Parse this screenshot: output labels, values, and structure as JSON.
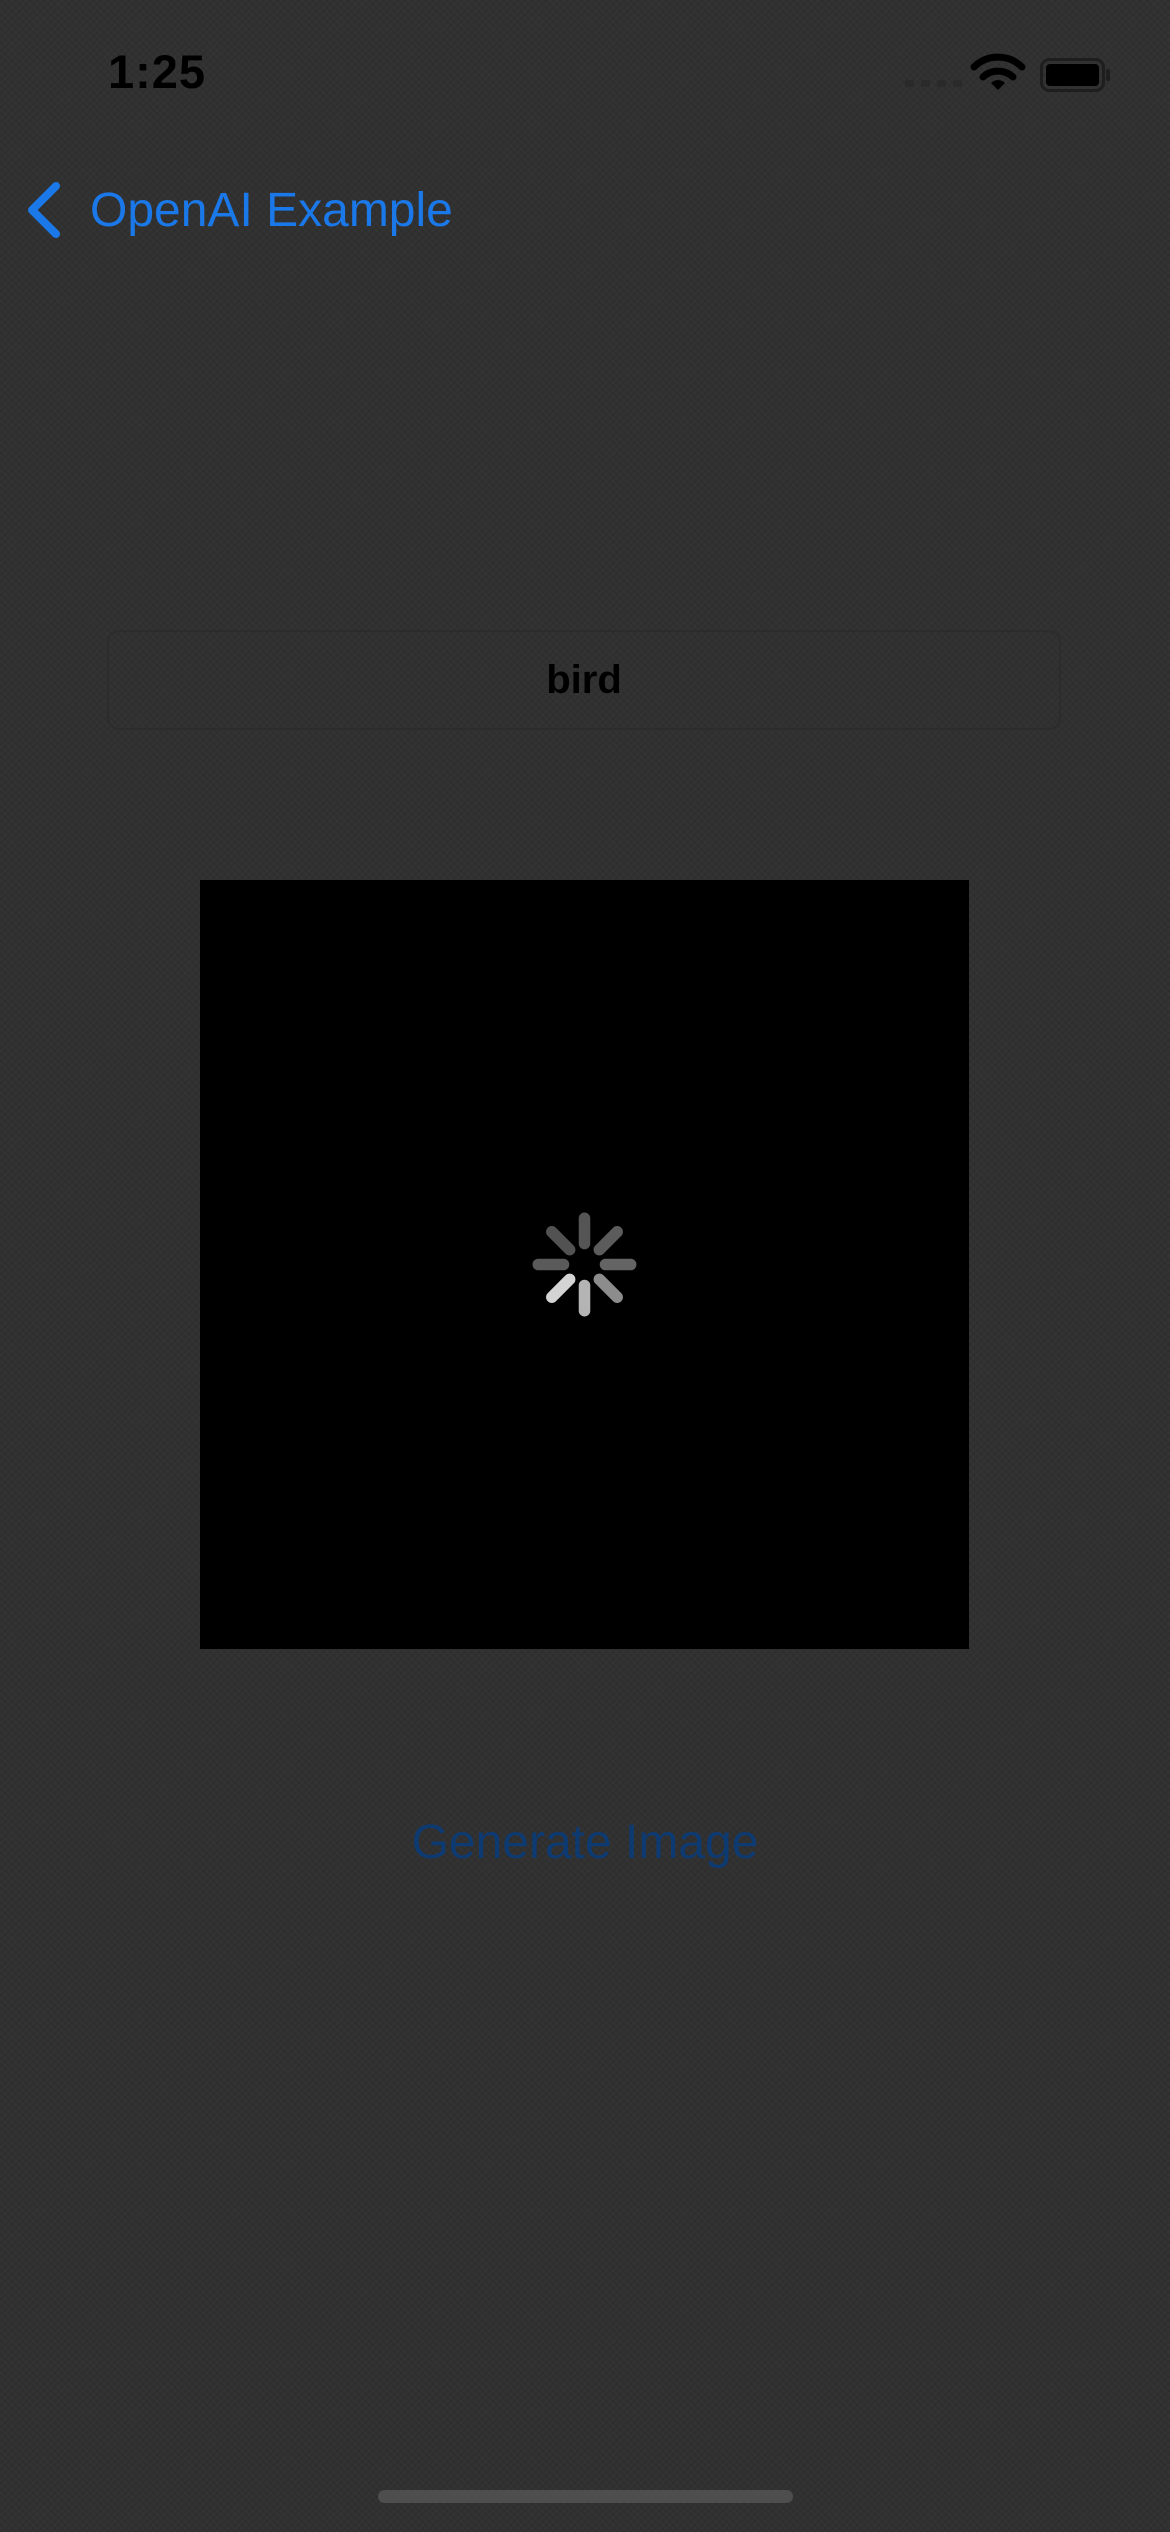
{
  "status_bar": {
    "time": "1:25",
    "icons": [
      "signal-icon",
      "wifi-icon",
      "battery-icon"
    ]
  },
  "nav": {
    "back_label": "OpenAI Example",
    "back_icon": "chevron-left-icon",
    "accent_color": "#1a78e8"
  },
  "prompt": {
    "value": "bird"
  },
  "image": {
    "state_icon": "loading-spinner-icon"
  },
  "actions": {
    "generate_label": "Generate Image"
  }
}
